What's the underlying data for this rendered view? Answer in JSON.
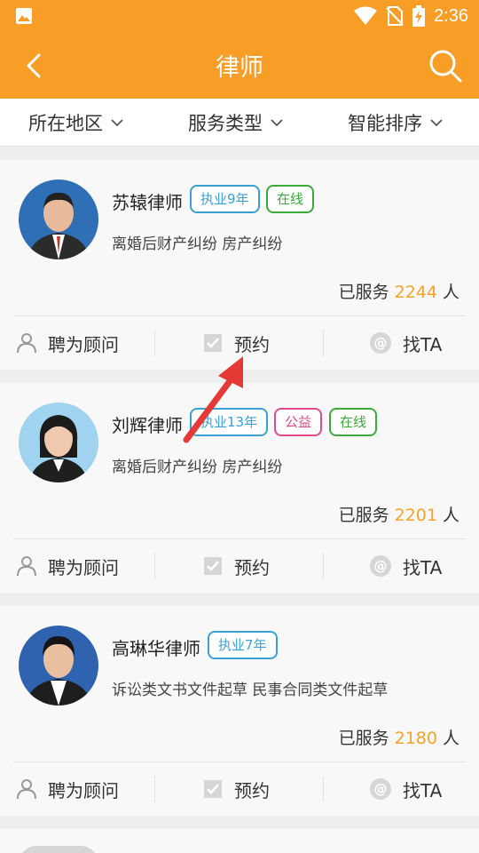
{
  "status_bar": {
    "time": "2:36"
  },
  "app_bar": {
    "title": "律师"
  },
  "filters": [
    {
      "label": "所在地区"
    },
    {
      "label": "服务类型"
    },
    {
      "label": "智能排序"
    }
  ],
  "lawyers": [
    {
      "name": "苏辕律师",
      "tags": [
        {
          "text": "执业9年",
          "color": "blue"
        },
        {
          "text": "在线",
          "color": "green"
        }
      ],
      "specialties": "离婚后财产纠纷 房产纠纷",
      "served_prefix": "已服务",
      "served_count": "2244",
      "served_suffix": "人",
      "avatar_bg": "#2e6fb5"
    },
    {
      "name": "刘辉律师",
      "tags": [
        {
          "text": "执业13年",
          "color": "blue"
        },
        {
          "text": "公益",
          "color": "pink"
        },
        {
          "text": "在线",
          "color": "green"
        }
      ],
      "specialties": "离婚后财产纠纷 房产纠纷",
      "served_prefix": "已服务",
      "served_count": "2201",
      "served_suffix": "人",
      "avatar_bg": "#9fd3ef"
    },
    {
      "name": "高琳华律师",
      "tags": [
        {
          "text": "执业7年",
          "color": "blue"
        }
      ],
      "specialties": "诉讼类文书文件起草 民事合同类文件起草",
      "served_prefix": "已服务",
      "served_count": "2180",
      "served_suffix": "人",
      "avatar_bg": "#2f63b0"
    }
  ],
  "actions": {
    "consultant": "聘为顾问",
    "appointment": "预约",
    "find": "找TA"
  },
  "colors": {
    "brand": "#f89d26",
    "served_number": "#f5a32a",
    "annotation_arrow": "#e53935"
  }
}
